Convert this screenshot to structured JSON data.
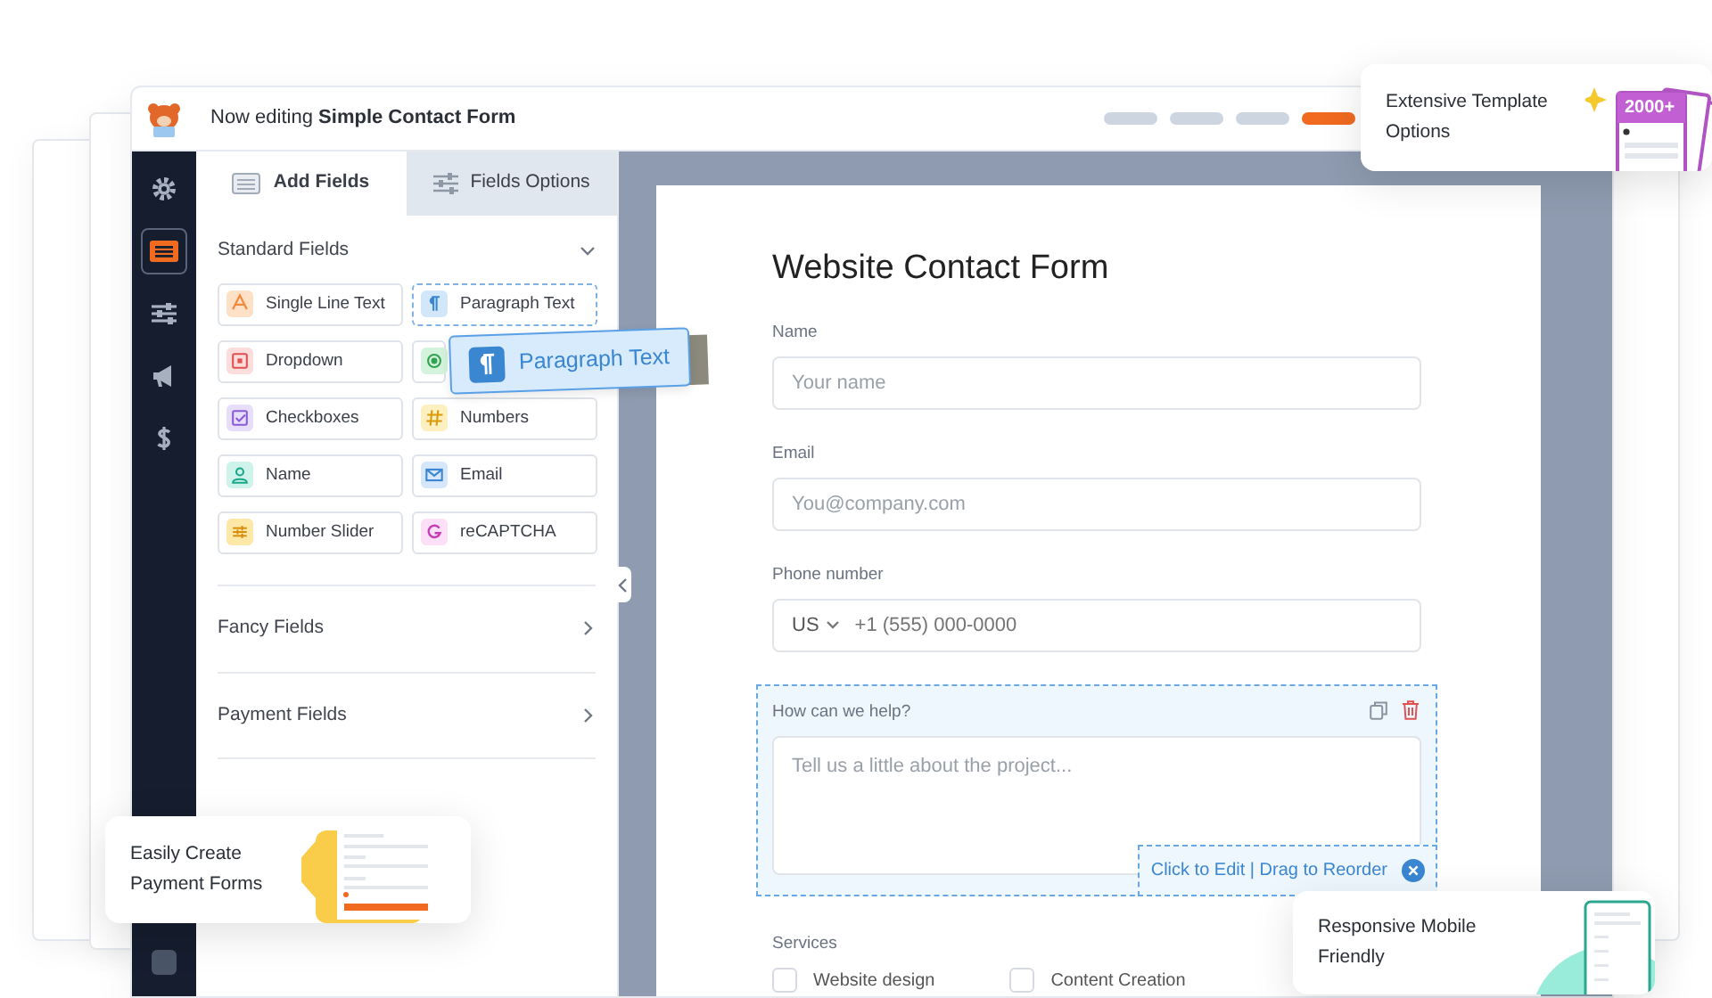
{
  "topbar": {
    "title": "Now editing **Simple Contact Form**",
    "steps": [
      {
        "selected": false
      },
      {
        "selected": false
      },
      {
        "selected": false
      },
      {
        "selected": true
      }
    ]
  },
  "sidebar": {
    "items": [
      {
        "kind": "settings",
        "selected": false
      },
      {
        "kind": "fields",
        "selected": true
      },
      {
        "kind": "sliders",
        "selected": false
      },
      {
        "kind": "marketing",
        "selected": false
      },
      {
        "kind": "payments",
        "selected": false
      }
    ]
  },
  "tabs": [
    {
      "kind": "fields",
      "label": "Add Fields",
      "selected": true
    },
    {
      "kind": "options",
      "label": "Fields Options",
      "selected": false
    }
  ],
  "sections": [
    {
      "title": "Standard Fields",
      "expanded": true,
      "fields": [
        {
          "kind": "text",
          "label": "Single Line Text",
          "dragging": false
        },
        {
          "kind": "paragraph",
          "label": "Paragraph Text",
          "dragging": true
        },
        {
          "kind": "dropdown",
          "label": "Dropdown",
          "dragging": false
        },
        {
          "kind": "radio",
          "dragging": false
        },
        {
          "kind": "checkbox",
          "label": "Checkboxes",
          "dragging": false
        },
        {
          "kind": "number",
          "label": "Numbers",
          "dragging": false
        },
        {
          "kind": "name",
          "label": "Name",
          "dragging": false
        },
        {
          "kind": "email",
          "label": "Email",
          "dragging": false
        },
        {
          "kind": "slider",
          "label": "Number Slider",
          "dragging": false
        },
        {
          "kind": "captcha",
          "label": "reCAPTCHA",
          "dragging": false
        }
      ]
    },
    {
      "title": "Fancy Fields",
      "expanded": false
    },
    {
      "title": "Payment Fields",
      "expanded": false
    }
  ],
  "dragged_chip": {
    "kind": "paragraph",
    "label": "Paragraph Text"
  },
  "form": {
    "title": "Website Contact Form",
    "fields": [
      {
        "kind": "input",
        "label": "Name",
        "placeholder": "Your name"
      },
      {
        "kind": "input",
        "label": "Email",
        "placeholder": "You@company.com"
      },
      {
        "kind": "phone",
        "label": "Phone number",
        "country": "US",
        "placeholder": "+1 (555) 000-0000"
      },
      {
        "kind": "textarea",
        "label": "How can we help?",
        "placeholder": "Tell us a little about the project...",
        "selected": true,
        "hint": "Click to Edit | Drag to Reorder"
      },
      {
        "kind": "checkboxes",
        "label": "Services",
        "options": [
          {
            "label": "Website design",
            "checked": false
          },
          {
            "label": "Content Creation",
            "checked": false
          }
        ]
      }
    ]
  },
  "callouts": [
    {
      "kind": "templates",
      "text": "Extensive Template Options",
      "badge": "2000+"
    },
    {
      "kind": "payments",
      "text": "Easily Create Payment Forms"
    },
    {
      "kind": "mobile",
      "text": "Responsive Mobile Friendly"
    }
  ]
}
